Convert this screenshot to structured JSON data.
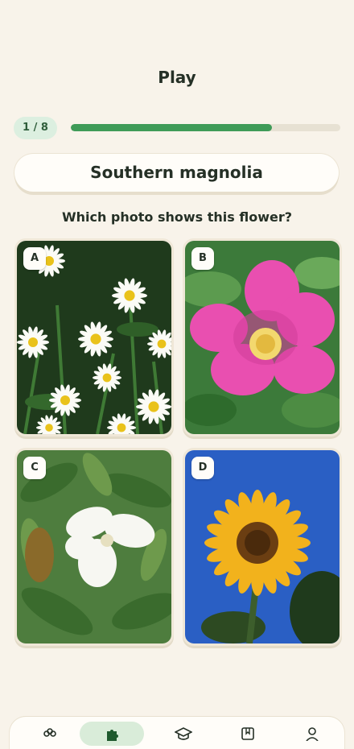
{
  "header": {
    "title": "Play"
  },
  "progress": {
    "label": "1 / 8",
    "fraction": 0.745
  },
  "quiz": {
    "flower_name": "Southern magnolia",
    "question": "Which photo shows this flower?",
    "options": [
      {
        "label": "A",
        "subject": "daisies"
      },
      {
        "label": "B",
        "subject": "pink wild rose"
      },
      {
        "label": "C",
        "subject": "white magnolia"
      },
      {
        "label": "D",
        "subject": "sunflower"
      }
    ]
  },
  "nav": {
    "items": [
      {
        "icon": "flower-icon"
      },
      {
        "icon": "puzzle-icon",
        "active": true
      },
      {
        "icon": "graduation-cap-icon"
      },
      {
        "icon": "book-icon"
      },
      {
        "icon": "person-icon"
      }
    ]
  },
  "colors": {
    "accent": "#3f9b58",
    "background": "#f8f3ea",
    "active_nav": "#d9ecd9"
  }
}
